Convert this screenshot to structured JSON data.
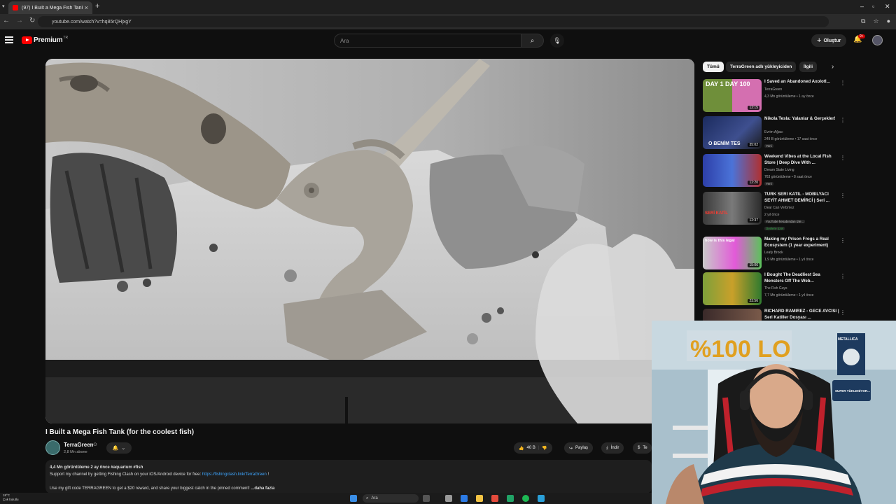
{
  "browser": {
    "tab_title": "(97) I Built a Mega Fish Tank (f...",
    "url": "youtube.com/watch?v=hq85rQHjxgY"
  },
  "header": {
    "brand": "Premium",
    "brand_sup": "TR",
    "search_placeholder": "Ara",
    "create_label": "Oluştur",
    "notification_count": "9+"
  },
  "video": {
    "title": "I Built a Mega Fish Tank (for the coolest fish)",
    "channel": "TerraGreen",
    "subscribers": "2,8 Mn abone",
    "like_count": "40 B",
    "share_label": "Paylaş",
    "download_label": "İndir",
    "thanks_label": "Te",
    "description": {
      "stats": "4,4 Mn görüntüleme  2 ay önce  #aquarium #fish",
      "line1": "Support my channel by getting Fishing Clash on your iOS/Android device for free: ",
      "link": "https://fishingclash.link/TerraGreen",
      "line1_end": " !",
      "line2": "Use my gift code TERRAGREEN to get a $20 reward, and share your biggest catch in the pinned comment!",
      "more": "...daha fazla"
    }
  },
  "sidebar": {
    "chips": [
      "Tümü",
      "TerraGreen adlı yükleyiciden",
      "İlgili"
    ],
    "items": [
      {
        "title": "I Saved an Abandoned Axolotl...",
        "channel": "TerraGreen",
        "meta": "4,3 Mn görüntüleme • 1 ay önce",
        "tag": "",
        "duration": "12:15",
        "thumb_text": "DAY 1  DAY 100"
      },
      {
        "title": "Nikola Tesla: Yalanlar & Gerçekler!",
        "channel": "Evrim Ağacı",
        "meta": "249 B görüntüleme • 17 saat önce",
        "tag": "Yeni",
        "duration": "35:02",
        "thumb_text": "O BENİM TES"
      },
      {
        "title": "Weekend Vibes at the Local Fish Store | Deep Dive With ...",
        "channel": "Dream State Living",
        "meta": "763 görüntüleme • 8 saat önce",
        "tag": "Yeni",
        "duration": "12:20",
        "thumb_text": ""
      },
      {
        "title": "TÜRK SERİ KATİL - MOBİLYACI SEYİT AHMET DEMİRCİ | Seri ...",
        "channel": "Dear Can Verbmez",
        "meta": "2 yıl önce",
        "tag": "YouTube hesabından izle...",
        "tag2": "Üyelere özel",
        "duration": "12:37",
        "thumb_text": "SERİ KATİL"
      },
      {
        "title": "Making my Prison Frogs a Real Ecosystem (1 year experiment)",
        "channel": "Leafy Brook",
        "meta": "1,9 Mn görüntüleme • 1 yıl önce",
        "tag": "",
        "duration": "15:06",
        "thumb_text": "how is this legal"
      },
      {
        "title": "I Bought The Deadliest Sea Monsters Off The Web...",
        "channel": "The Fish Guys",
        "meta": "7,7 Mn görüntüleme • 1 yıl önce",
        "tag": "",
        "duration": "23:56",
        "thumb_text": ""
      },
      {
        "title": "RICHARD RAMIREZ - GECE AVCISI | Seri Katiller Dosyası ...",
        "channel": "",
        "meta": "",
        "tag": "",
        "duration": "",
        "thumb_text": ""
      }
    ]
  },
  "webcam": {
    "sign_text": "%100 LO",
    "poster_text": "METALLICA",
    "poster_caption": "SUPER YÜKLENİYOR..."
  },
  "taskbar": {
    "temperature": "18°C",
    "weather": "Çok bulutlu",
    "search_label": "Ara"
  },
  "colors": {
    "accent": "#ff0000",
    "link": "#3ea6ff",
    "background": "#0f0f0f"
  }
}
